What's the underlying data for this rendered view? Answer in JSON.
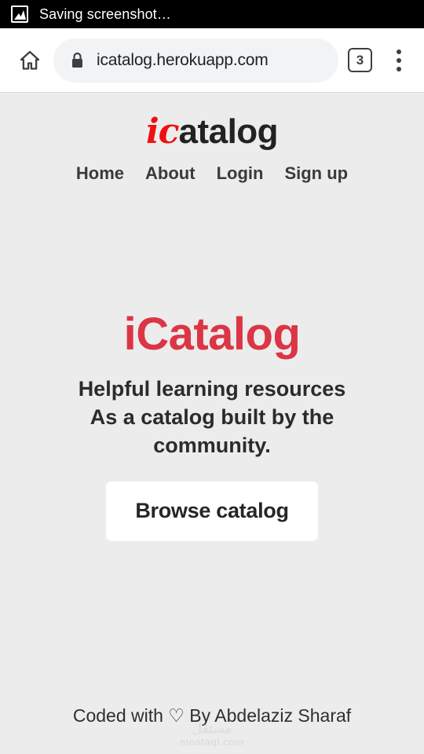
{
  "status_bar": {
    "icon": "screenshot-image-icon",
    "text": "Saving screenshot…"
  },
  "browser": {
    "home_icon": "home-icon",
    "lock_icon": "lock-icon",
    "url": "icatalog.herokuapp.com",
    "tab_count": "3",
    "menu_icon": "overflow-menu-icon"
  },
  "site": {
    "logo_accent": "ic",
    "logo_rest": "atalog",
    "nav": [
      {
        "label": "Home"
      },
      {
        "label": "About"
      },
      {
        "label": "Login"
      },
      {
        "label": "Sign up"
      }
    ],
    "hero": {
      "title": "iCatalog",
      "subtitle": "Helpful learning resources As a catalog built by the community.",
      "cta_label": "Browse catalog"
    },
    "footer": {
      "text": "Coded with ♡ By Abdelaziz Sharaf"
    },
    "watermark": {
      "arabic": "مستقل",
      "latin": "mostaql.com"
    }
  },
  "colors": {
    "brand_red": "#dc3545",
    "logo_red": "#ee1111",
    "page_bg": "#ececec",
    "toolbar_bg": "#ffffff",
    "status_bg": "#000000",
    "text_dark": "#2b2b2b"
  }
}
